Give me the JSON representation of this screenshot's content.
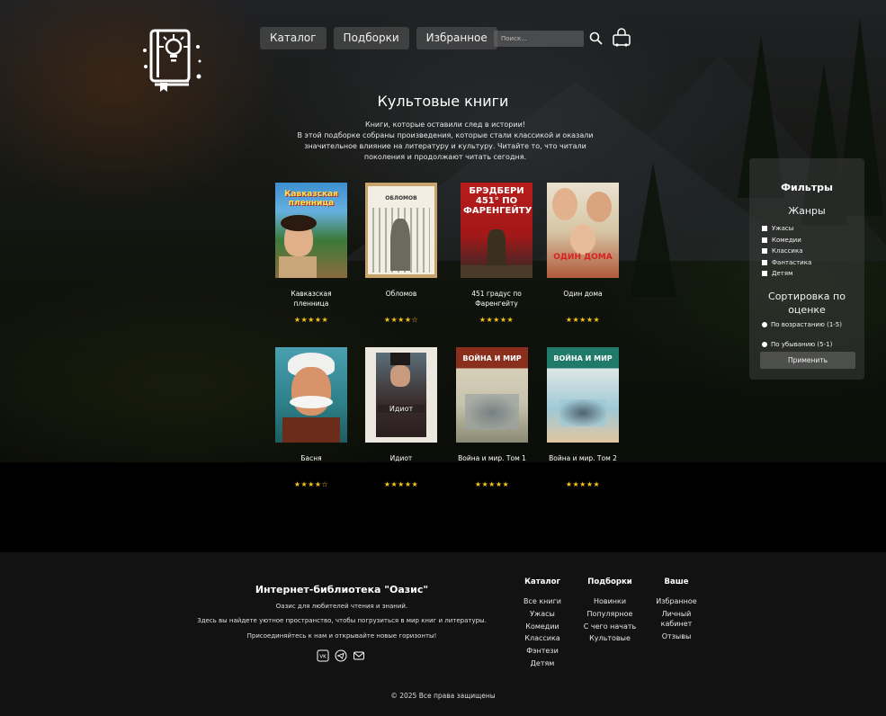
{
  "nav": {
    "items": [
      "Каталог",
      "Подборки",
      "Избранное"
    ],
    "search_placeholder": "Поиск..."
  },
  "icons": {
    "logo": "book-lightbulb-icon",
    "search": "search-icon",
    "cart": "cart-icon",
    "socials": [
      "vk-icon",
      "telegram-icon",
      "mail-icon"
    ]
  },
  "colors": {
    "star": "#f5c518",
    "panel": "#3c3c3c",
    "footer_bg": "#121212"
  },
  "page": {
    "title": "Культовые книги",
    "intro": [
      "Книги, которые оставили след в истории!",
      "В этой подборке собраны произведения, которые стали классикой и оказали",
      "значительное влияние на литературу и культуру. Читайте то, что читали",
      "поколения и продолжают читать сегодня."
    ]
  },
  "books": [
    {
      "title": "Кавказская пленница",
      "cover_text": "Кавказская пленница",
      "rating": 5
    },
    {
      "title": "Обломов",
      "cover_text": "ОБЛОМОВ",
      "rating": 4.5
    },
    {
      "title": "451 градус по Фаренгейту",
      "cover_text": "БРЭДБЕРИ 451° ПО ФАРЕНГЕЙТУ",
      "rating": 5
    },
    {
      "title": "Один дома",
      "cover_text": "ОДИН ДОМА",
      "rating": 5
    },
    {
      "title": "Басня",
      "cover_text": "",
      "rating": 4.5
    },
    {
      "title": "Идиот",
      "cover_text": "Идиот",
      "rating": 5
    },
    {
      "title": "Война и мир. Том 1",
      "cover_text": "ВОЙНА И МИР",
      "rating": 5
    },
    {
      "title": "Война и мир. Том 2",
      "cover_text": "ВОЙНА И МИР",
      "rating": 5
    }
  ],
  "filters": {
    "title": "Фильтры",
    "genres_title": "Жанры",
    "genres": [
      "Ужасы",
      "Комедии",
      "Классика",
      "Фантастика",
      "Детям"
    ],
    "sort_title_1": "Сортировка по",
    "sort_title_2": "оценке",
    "sort_options": [
      "По возрастанию (1-5)",
      "По убыванию (5-1)"
    ],
    "apply_label": "Применить"
  },
  "footer": {
    "title": "Интернет-библиотека \"Оазис\"",
    "lines": [
      "Оазис для любителей чтения и знаний.",
      "Здесь вы найдете уютное пространство, чтобы погрузиться в мир книг и литературы.",
      "Присоединяйтесь к нам и открывайте новые горизонты!"
    ],
    "columns": [
      {
        "heading": "Каталог",
        "links": [
          "Все книги",
          "Ужасы",
          "Комедии",
          "Классика",
          "Фэнтези",
          "Детям"
        ]
      },
      {
        "heading": "Подборки",
        "links": [
          "Новинки",
          "Популярное",
          "С чего начать",
          "Культовые"
        ]
      },
      {
        "heading": "Ваше",
        "links": [
          "Избранное",
          "Личный кабинет",
          "Отзывы"
        ]
      }
    ],
    "copyright": "© 2025 Все права защищены"
  }
}
